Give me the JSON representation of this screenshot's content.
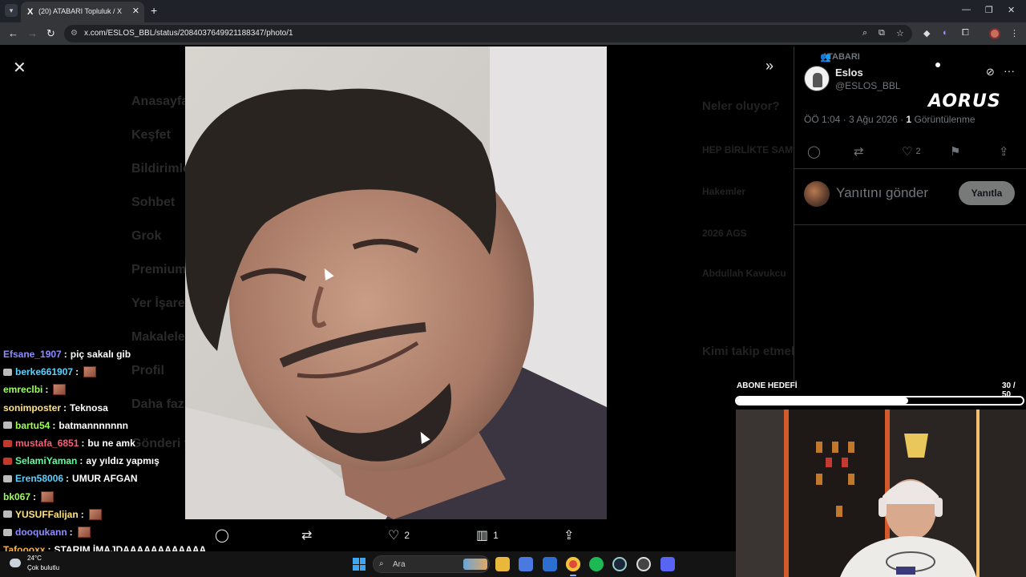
{
  "browser": {
    "tab_counter_icon": "chevron-down-icon",
    "tab_title": "(20) ATABARI Topluluk / X",
    "tab_favicon": "X",
    "url": "x.com/ESLOS_BBL/status/2084037649921188347/photo/1"
  },
  "background_x": {
    "nav": [
      "Anasayfa",
      "Keşfet",
      "Bildirimler",
      "Sohbet",
      "Grok",
      "Premium",
      "Yer İşaretleri",
      "Makaleler",
      "Profil",
      "Daha fazla",
      "Gönderi yayınla"
    ],
    "right": [
      "Neler oluyor?",
      "HEP BİRLİKTE SAMİ",
      "Hakemler",
      "2026 AGS",
      "Abdullah Kavukcu",
      "Kimi takip etmeli"
    ]
  },
  "photo_actions": {
    "reply_count": "",
    "repost_count": "",
    "like_count": "2",
    "views_count": "1"
  },
  "tweet": {
    "community": "ATABARI",
    "author_name": "Eslos",
    "author_handle": "@ESLOS_BBL",
    "time": "ÖÖ 1:04 · 3 Ağu 2026 · ",
    "views_num": "1",
    "views_label": " Görüntülenme",
    "like_count": "2",
    "reply_placeholder": "Yanıtını gönder",
    "reply_button": "Yanıtla"
  },
  "overlay": {
    "brand": "AORUS",
    "goal_label": "ABONE HEDEFİ",
    "goal_count": "30 / 50",
    "goal_progress": 0.6
  },
  "chat": [
    {
      "user": "Efsane_1907",
      "color": "#8f8cff",
      "text": "piç sakalı gib",
      "badge": "none",
      "emote": false
    },
    {
      "user": "berke661907",
      "color": "#5ad1ff",
      "text": "",
      "badge": "gray",
      "emote": true
    },
    {
      "user": "emreclbi",
      "color": "#9cff5a",
      "text": "",
      "badge": "none",
      "emote": true
    },
    {
      "user": "sonimposter",
      "color": "#ffe27a",
      "text": "Teknosa",
      "badge": "none",
      "emote": false
    },
    {
      "user": "bartu54",
      "color": "#9cff5a",
      "text": "batmannnnnnn",
      "badge": "gray",
      "emote": false
    },
    {
      "user": "mustafa_6851",
      "color": "#ff5c7a",
      "text": "bu ne amk",
      "badge": "red",
      "emote": false
    },
    {
      "user": "SelamiYaman",
      "color": "#5aff9c",
      "text": "ay yıldız yapmış",
      "badge": "red",
      "emote": false
    },
    {
      "user": "Eren58006",
      "color": "#5ad1ff",
      "text": "UMUR AFGAN",
      "badge": "gray",
      "emote": false
    },
    {
      "user": "bk067",
      "color": "#9cff5a",
      "text": "",
      "badge": "none",
      "emote": true
    },
    {
      "user": "YUSUFFalijan",
      "color": "#ffe27a",
      "text": "",
      "badge": "gray",
      "emote": true
    },
    {
      "user": "dooqukann",
      "color": "#8f8cff",
      "text": "",
      "badge": "gray",
      "emote": true
    },
    {
      "user": "Tafoooxx",
      "color": "#ffb347",
      "text": "STARIM İMAJDAAAAAAAAAAAA",
      "badge": "none",
      "emote": false
    }
  ],
  "taskbar": {
    "temperature": "24°C",
    "weather": "Çok bulutlu",
    "search": "Ara"
  }
}
